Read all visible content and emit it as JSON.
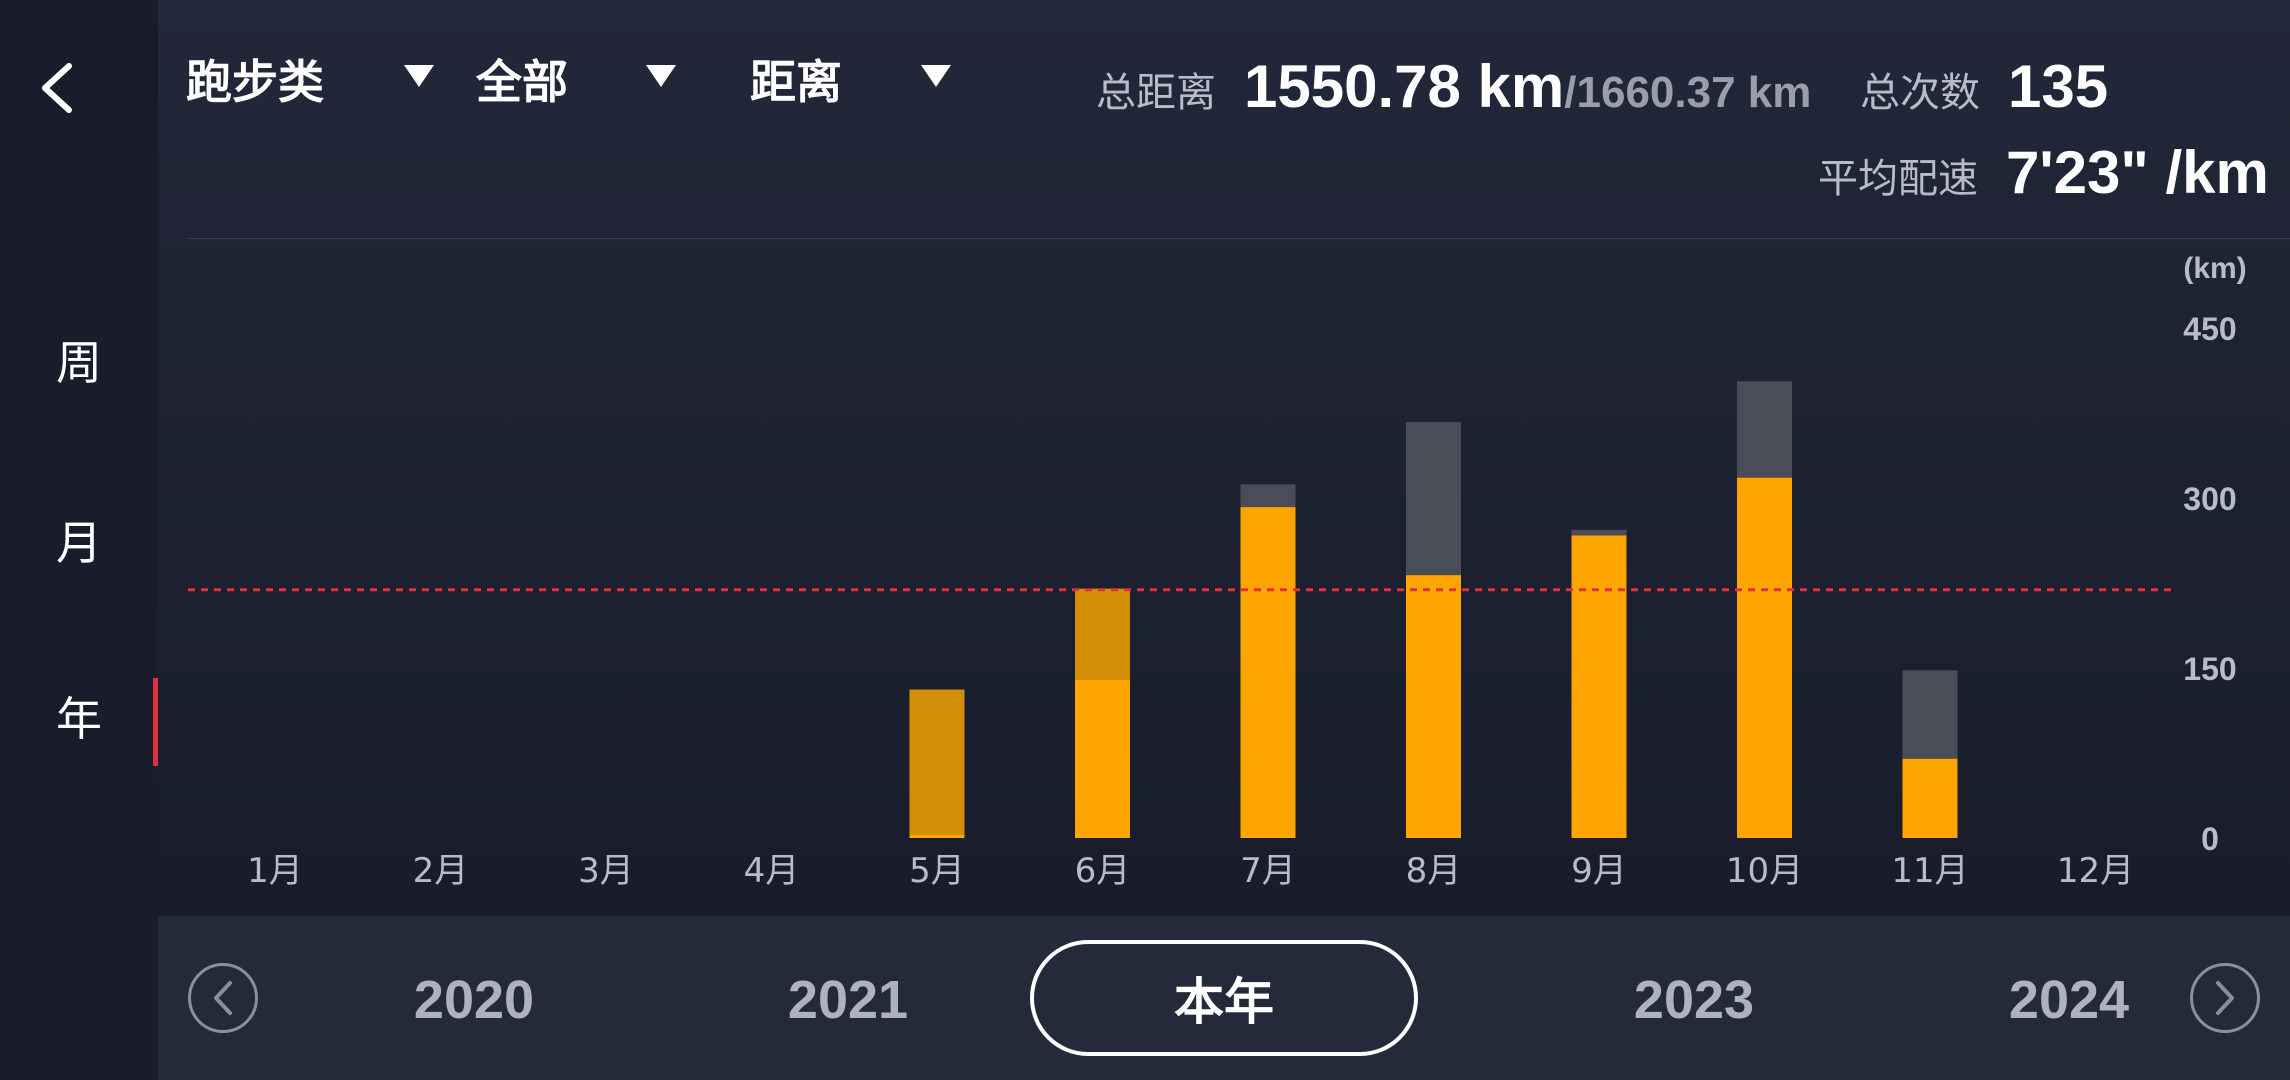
{
  "sidebar": {
    "back_icon": "chevron-left-icon",
    "periods": [
      "周",
      "月",
      "年"
    ],
    "active_period": "年"
  },
  "filters": {
    "sport": "跑步类",
    "scope": "全部",
    "metric": "距离"
  },
  "stats": {
    "total_distance_label": "总距离",
    "total_distance_value": "1550.78 km",
    "total_distance_sub": "/1660.37 km",
    "total_count_label": "总次数",
    "total_count_value": "135",
    "avg_pace_label": "平均配速",
    "avg_pace_value": "7'23\" /km"
  },
  "chart_data": {
    "type": "bar",
    "unit_label": "(km)",
    "categories": [
      "1月",
      "2月",
      "3月",
      "4月",
      "5月",
      "6月",
      "7月",
      "8月",
      "9月",
      "10月",
      "11月",
      "12月"
    ],
    "yticks": [
      0,
      150,
      300,
      450
    ],
    "ylim": [
      0,
      450
    ],
    "axis_ticks_shown": [
      "0",
      "150",
      "300",
      "450"
    ],
    "series": [
      {
        "values": [
          0,
          0,
          0,
          0,
          3,
          140,
          292,
          232,
          267,
          318,
          70,
          0
        ],
        "color": "#ffa500"
      },
      {
        "values": [
          0,
          0,
          0,
          0,
          0,
          0,
          20,
          135,
          5,
          85,
          78,
          0
        ],
        "color": "#4a4c57"
      },
      {
        "values": [
          0,
          0,
          0,
          0,
          128,
          80,
          0,
          0,
          0,
          0,
          0,
          0
        ],
        "color": "#d28e05"
      }
    ],
    "reference_line": {
      "value": 219,
      "color": "#e3303f",
      "style": "dashed"
    },
    "grid": false
  },
  "year_nav": {
    "prev_icon": "chevron-left-circle-icon",
    "next_icon": "chevron-right-circle-icon",
    "years": [
      "2020",
      "2021",
      "本年",
      "2023",
      "2024"
    ],
    "selected": "本年"
  }
}
